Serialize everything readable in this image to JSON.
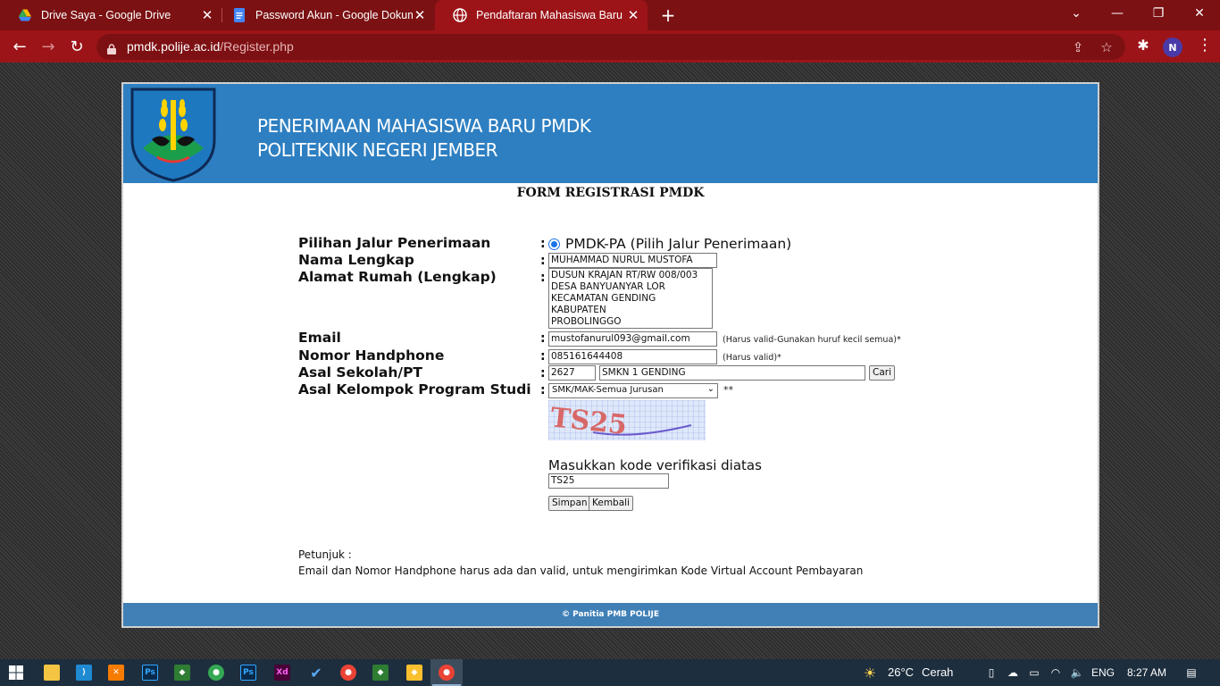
{
  "browser": {
    "tabs": [
      {
        "title": "Drive Saya - Google Drive"
      },
      {
        "title": "Password Akun - Google Dokumen"
      },
      {
        "title": "Pendaftaran Mahasiswa Baru"
      }
    ],
    "url_domain": "pmdk.polije.ac.id",
    "url_path": "/Register.php",
    "profile_initial": "N"
  },
  "page": {
    "banner_line1": "PENERIMAAN MAHASISWA BARU PMDK",
    "banner_line2": "POLITEKNIK NEGERI JEMBER",
    "form_title": "FORM REGISTRASI PMDK",
    "fields": {
      "jalur": {
        "label": "Pilihan Jalur Penerimaan",
        "option": "PMDK-PA (Pilih Jalur Penerimaan)"
      },
      "nama": {
        "label": "Nama Lengkap",
        "value": "MUHAMMAD NURUL MUSTOFA"
      },
      "alamat": {
        "label": "Alamat Rumah (Lengkap)",
        "value": "DUSUN KRAJAN RT/RW 008/003\nDESA BANYUANYAR LOR\nKECAMATAN GENDING KABUPATEN\nPROBOLINGGO"
      },
      "email": {
        "label": "Email",
        "value": "mustofanurul093@gmail.com",
        "hint": "(Harus valid-Gunakan huruf kecil semua)*"
      },
      "hp": {
        "label": "Nomor Handphone",
        "value": "085161644408",
        "hint": "(Harus valid)*"
      },
      "sekolah": {
        "label": "Asal Sekolah/PT",
        "code": "2627",
        "name": "SMKN 1 GENDING",
        "button": "Cari"
      },
      "prodi": {
        "label": "Asal Kelompok Program Studi",
        "selected": "SMK/MAK-Semua Jurusan",
        "note": "**"
      }
    },
    "colon": ":",
    "captcha_text": "TS25",
    "verif_label": "Masukkan kode verifikasi diatas",
    "verif_value": "TS25",
    "btn_simpan": "Simpan",
    "btn_kembali": "Kembali",
    "petunjuk_title": "Petunjuk :",
    "petunjuk_text": "Email dan Nomor Handphone harus ada dan valid, untuk mengirimkan Kode Virtual Account Pembayaran",
    "footer": "© Panitia PMB POLIJE"
  },
  "taskbar": {
    "weather": "26°C",
    "weather_desc": "Cerah",
    "lang": "ENG",
    "time": "8:27 AM"
  },
  "colors": {
    "chrome_frame": "#7b1113",
    "chrome_toolbar": "#9c1418",
    "banner": "#2e7fc1",
    "footer": "#4080b7",
    "taskbar": "#1d2e3e"
  }
}
